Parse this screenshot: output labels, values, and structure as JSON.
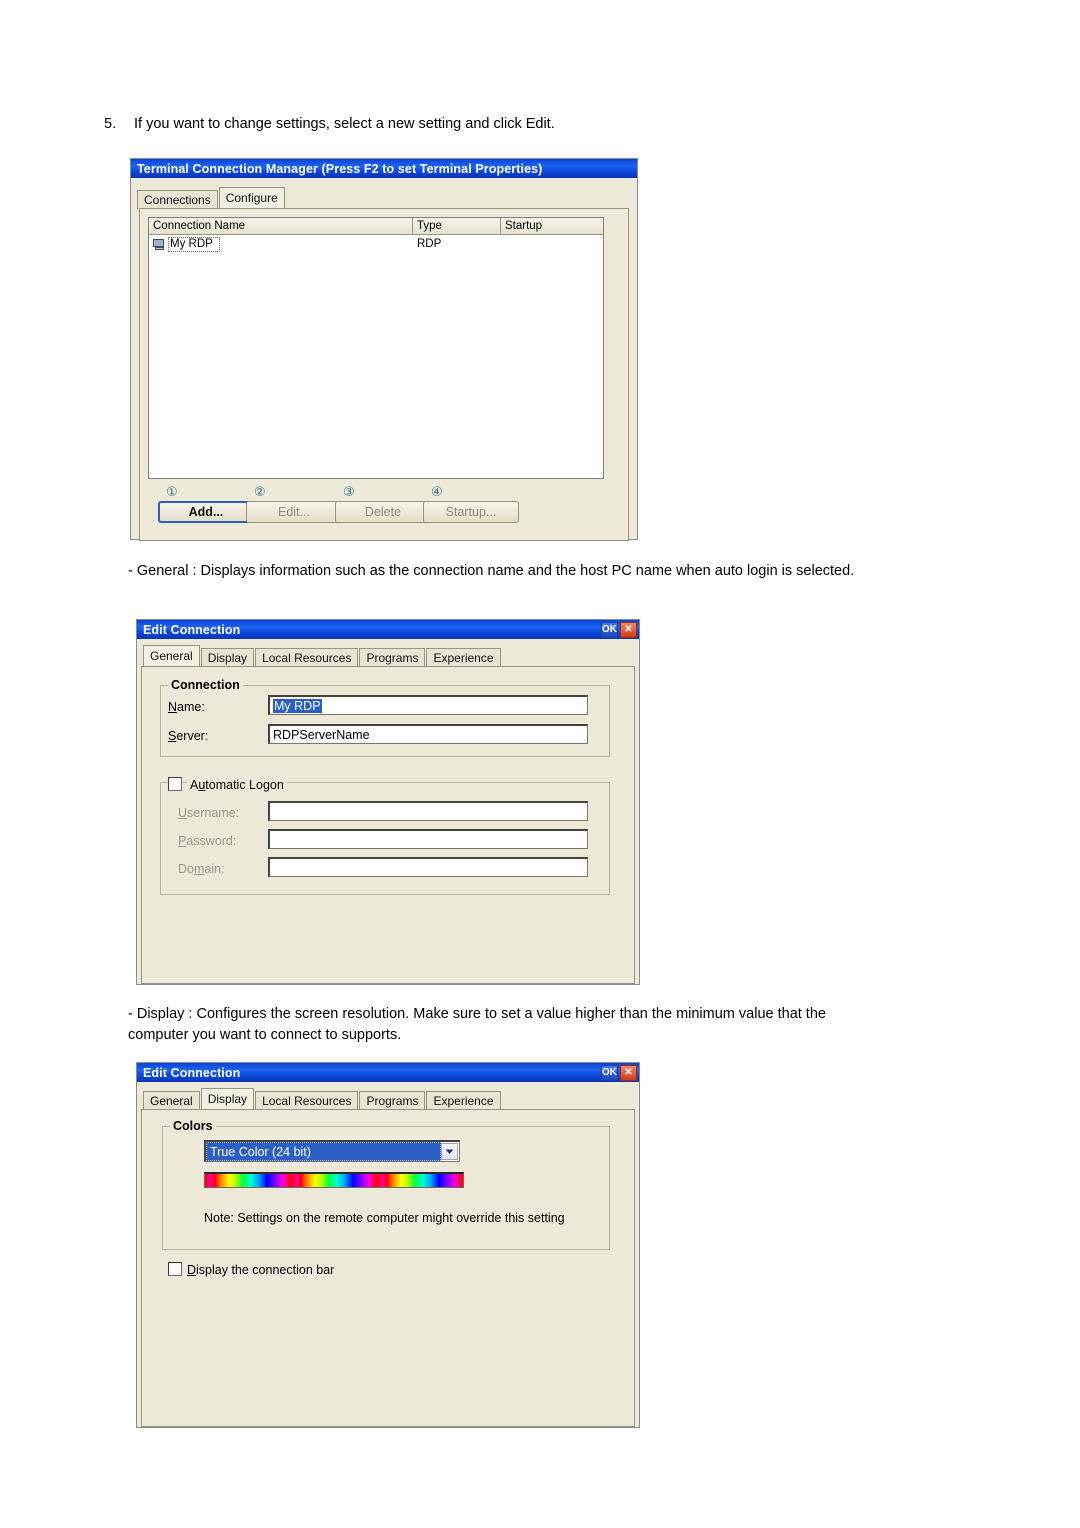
{
  "document": {
    "step_number": "5.",
    "step_text": "If you want to change settings, select a new setting and click Edit.",
    "general_note": "- General : Displays information such as the connection name and the host PC name when auto login is selected.",
    "display_note": "- Display : Configures the screen resolution. Make sure to set a value higher than the minimum value that the computer you want to connect to supports."
  },
  "terminal_manager": {
    "title": "Terminal Connection Manager (Press F2 to set Terminal Properties)",
    "tabs": [
      {
        "label": "Connections",
        "active": false
      },
      {
        "label": "Configure",
        "active": true
      }
    ],
    "list": {
      "columns": [
        "Connection Name",
        "Type",
        "Startup"
      ],
      "rows": [
        {
          "name": "My RDP",
          "type": "RDP",
          "startup": ""
        }
      ]
    },
    "buttons": [
      {
        "marker": "①",
        "label": "Add...",
        "accel": "A",
        "state": "default"
      },
      {
        "marker": "②",
        "label": "Edit...",
        "accel": "E",
        "state": "disabled"
      },
      {
        "marker": "③",
        "label": "Delete",
        "accel": "D",
        "state": "disabled"
      },
      {
        "marker": "④",
        "label": "Startup...",
        "accel": "S",
        "state": "disabled"
      }
    ]
  },
  "edit_connection_general": {
    "title": "Edit Connection",
    "titlebar_buttons": {
      "ok": "OK",
      "close": "✕"
    },
    "tabs": [
      {
        "label": "General",
        "active": true
      },
      {
        "label": "Display",
        "active": false
      },
      {
        "label": "Local Resources",
        "active": false
      },
      {
        "label": "Programs",
        "active": false
      },
      {
        "label": "Experience",
        "active": false
      }
    ],
    "connection_group": {
      "title": "Connection",
      "name_label": "Name:",
      "name_value": "My RDP",
      "server_label": "Server:",
      "server_value": "RDPServerName"
    },
    "auto_logon_group": {
      "checkbox_label": "Automatic Logon",
      "checked": false,
      "username_label": "Username:",
      "username_value": "",
      "password_label": "Password:",
      "password_value": "",
      "domain_label": "Domain:",
      "domain_value": ""
    }
  },
  "edit_connection_display": {
    "title": "Edit Connection",
    "titlebar_buttons": {
      "ok": "OK",
      "close": "✕"
    },
    "tabs": [
      {
        "label": "General",
        "active": false
      },
      {
        "label": "Display",
        "active": true
      },
      {
        "label": "Local Resources",
        "active": false
      },
      {
        "label": "Programs",
        "active": false
      },
      {
        "label": "Experience",
        "active": false
      }
    ],
    "colors_group": {
      "title": "Colors",
      "selected_option": "True Color (24 bit)",
      "note": "Note: Settings on the remote computer might override this setting"
    },
    "connection_bar": {
      "label": "Display the connection bar",
      "checked": false
    }
  },
  "colors": {
    "titlebar_blue": "#0a44d6",
    "dialog_face": "#ece9d8",
    "selection_blue": "#2b5fc4",
    "marker_teal": "#2a7a92",
    "close_red": "#d33a17"
  }
}
